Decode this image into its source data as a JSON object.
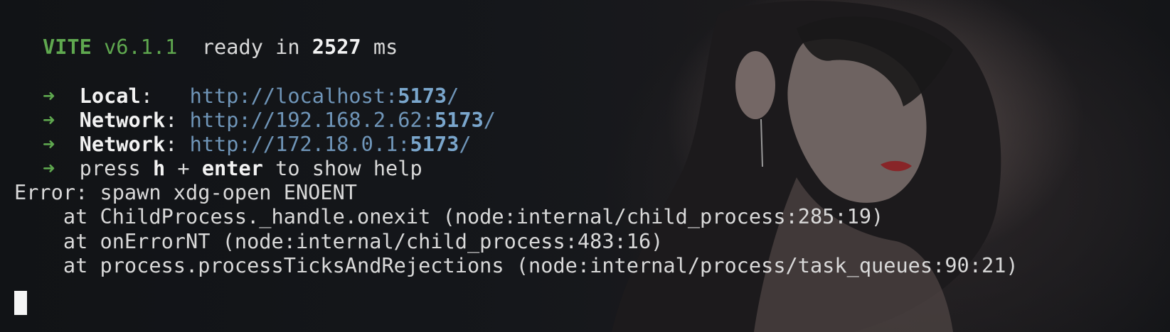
{
  "vite": {
    "name": "VITE",
    "version": "v6.1.1",
    "ready_prefix": "ready in",
    "ready_ms": "2527",
    "ready_unit": "ms"
  },
  "servers": [
    {
      "arrow": "➜",
      "label": "Local",
      "sep": ":   ",
      "url_prefix": "http://localhost:",
      "port": "5173",
      "url_suffix": "/"
    },
    {
      "arrow": "➜",
      "label": "Network",
      "sep": ": ",
      "url_prefix": "http://192.168.2.62:",
      "port": "5173",
      "url_suffix": "/"
    },
    {
      "arrow": "➜",
      "label": "Network",
      "sep": ": ",
      "url_prefix": "http://172.18.0.1:",
      "port": "5173",
      "url_suffix": "/"
    }
  ],
  "help": {
    "arrow": "➜",
    "press": "press",
    "key1": "h",
    "plus": "+",
    "key2": "enter",
    "rest": "to show help"
  },
  "error": {
    "message": "Error: spawn xdg-open ENOENT",
    "stack": [
      "    at ChildProcess._handle.onexit (node:internal/child_process:285:19)",
      "    at onErrorNT (node:internal/child_process:483:16)",
      "    at process.processTicksAndRejections (node:internal/process/task_queues:90:21)"
    ]
  },
  "colors": {
    "green": "#5fa84f",
    "url": "#6f95b8",
    "text": "#e6e6e6",
    "background": "#121418"
  }
}
